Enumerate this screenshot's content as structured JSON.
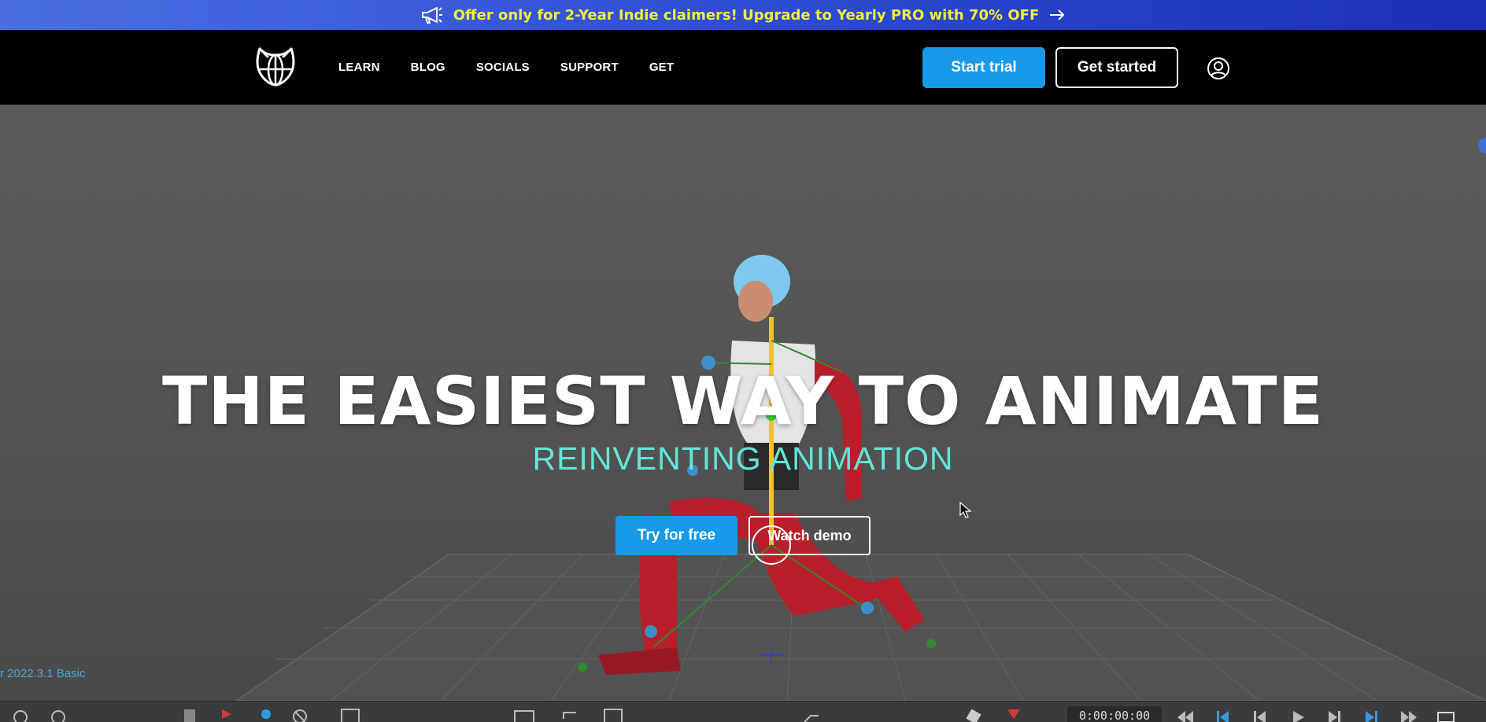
{
  "promo": {
    "text": "Offer only for 2-Year Indie claimers! Upgrade to Yearly PRO with 70% OFF",
    "icon": "megaphone-icon",
    "arrow_icon": "arrow-right-icon",
    "text_color": "#f4ef3a"
  },
  "header": {
    "logo_icon": "cat-globe-logo-icon",
    "nav": [
      "LEARN",
      "BLOG",
      "SOCIALS",
      "SUPPORT",
      "GET"
    ],
    "start_trial": "Start trial",
    "get_started": "Get started",
    "account_icon": "user-circle-icon",
    "accent": "#1899e8"
  },
  "hero": {
    "title": "THE EASIEST WAY TO ANIMATE",
    "subtitle": "REINVENTING ANIMATION",
    "subtitle_color": "#62e6d8",
    "try_button": "Try for free",
    "demo_button": "Watch demo",
    "version": "r 2022.3.1 Basic"
  },
  "toolbar": {
    "timecode": "0:00:00:00"
  }
}
